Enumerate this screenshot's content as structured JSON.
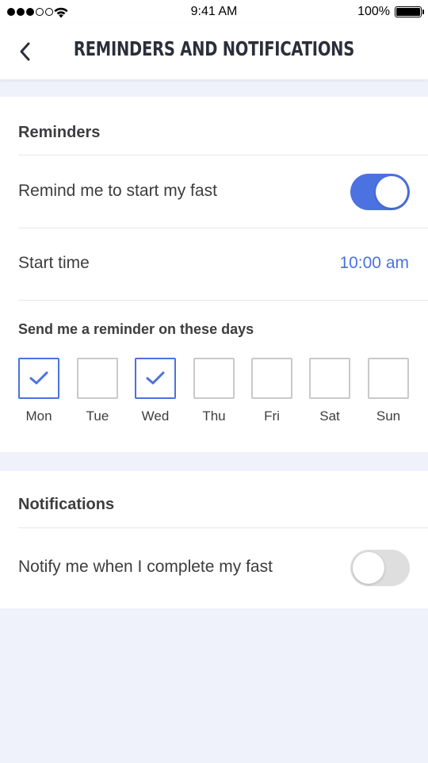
{
  "status_bar": {
    "time": "9:41 AM",
    "battery": "100%",
    "signal_icon": "signal-dots-icon",
    "wifi_icon": "wifi-icon",
    "battery_icon": "battery-icon"
  },
  "header": {
    "title": "REMINDERS AND NOTIFICATIONS",
    "back_icon": "chevron-left-icon"
  },
  "reminders": {
    "title": "Reminders",
    "remind_start_label": "Remind me to start my fast",
    "remind_start_on": true,
    "start_time_label": "Start time",
    "start_time_value": "10:00 am",
    "days_label": "Send me a reminder on these days",
    "days": [
      {
        "label": "Mon",
        "checked": true
      },
      {
        "label": "Tue",
        "checked": false
      },
      {
        "label": "Wed",
        "checked": true
      },
      {
        "label": "Thu",
        "checked": false
      },
      {
        "label": "Fri",
        "checked": false
      },
      {
        "label": "Sat",
        "checked": false
      },
      {
        "label": "Sun",
        "checked": false
      }
    ]
  },
  "notifications": {
    "title": "Notifications",
    "notify_complete_label": "Notify me when I complete my fast",
    "notify_complete_on": false
  },
  "colors": {
    "accent": "#4c71e0",
    "background": "#eff2fb",
    "toggle_off": "#dedede",
    "text": "#3d3d3f"
  }
}
